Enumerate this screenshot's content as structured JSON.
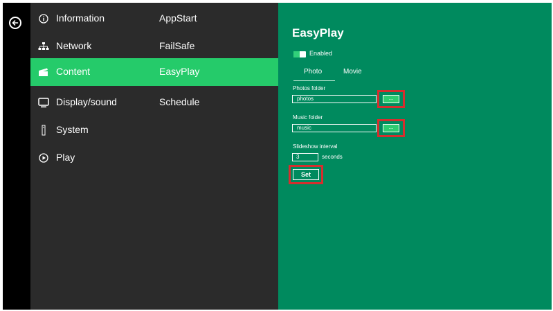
{
  "nav": {
    "back_icon": "arrow-left-circle-icon",
    "items": [
      {
        "label": "Information",
        "icon": "info-circle-icon",
        "sub": "AppStart"
      },
      {
        "label": "Network",
        "icon": "network-icon",
        "sub": "FailSafe"
      },
      {
        "label": "Content",
        "icon": "clapperboard-icon",
        "sub": "EasyPlay"
      },
      {
        "label": "Display/sound",
        "icon": "monitor-icon",
        "sub": "Schedule"
      },
      {
        "label": "System",
        "icon": "system-icon",
        "sub": ""
      },
      {
        "label": "Play",
        "icon": "play-circle-icon",
        "sub": ""
      }
    ],
    "active_index": 2
  },
  "easyplay": {
    "title": "EasyPlay",
    "enabled_label": "Enabled",
    "tabs": [
      "Photo",
      "Movie"
    ],
    "photos_folder": {
      "label": "Photos folder",
      "value": "photos",
      "browse": "..."
    },
    "music_folder": {
      "label": "Music folder",
      "value": "music",
      "browse": "..."
    },
    "slideshow": {
      "label": "Slideshow interval",
      "value": "3",
      "unit": "seconds"
    },
    "set_label": "Set"
  },
  "colors": {
    "accent_green": "#25cb6a",
    "panel_green": "#008a5e",
    "menu_dark": "#2b2b2b",
    "highlight_red": "#d62e2e"
  }
}
